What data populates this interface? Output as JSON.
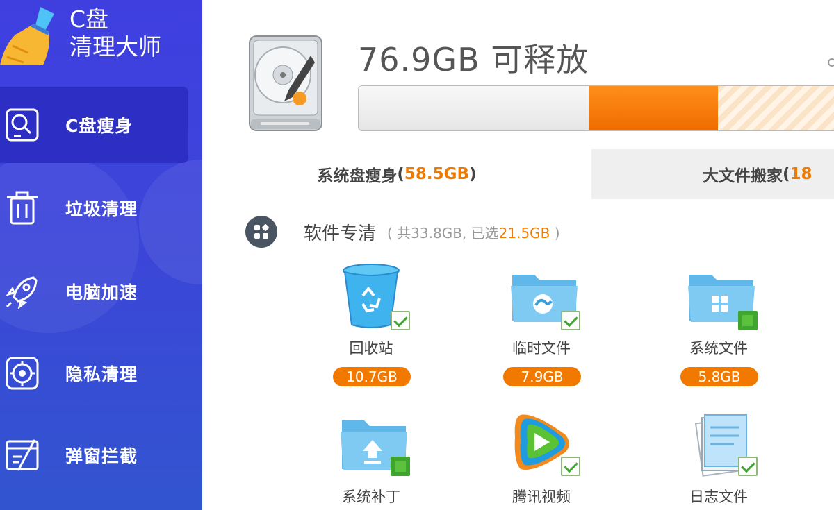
{
  "app": {
    "logo_line1": "C盘",
    "logo_line2": "清理大师"
  },
  "sidebar": {
    "items": [
      {
        "label": "C盘瘦身",
        "icon": "disk-magnifier-icon",
        "active": true
      },
      {
        "label": "垃圾清理",
        "icon": "trash-can-icon",
        "active": false
      },
      {
        "label": "电脑加速",
        "icon": "rocket-icon",
        "active": false
      },
      {
        "label": "隐私清理",
        "icon": "privacy-shield-icon",
        "active": false
      },
      {
        "label": "弹窗拦截",
        "icon": "popup-block-icon",
        "active": false
      }
    ]
  },
  "header": {
    "free_title": "76.9GB 可释放",
    "progress": {
      "used_fraction": 0.475,
      "releasable_fraction": 0.265,
      "other_fraction": 0.26
    }
  },
  "tabs": [
    {
      "label": "系统盘瘦身",
      "size": "58.5GB",
      "open": " (",
      "close": ")"
    },
    {
      "label": "大文件搬家",
      "size": "18",
      "open": " (",
      "close": ""
    }
  ],
  "section": {
    "title": "软件专清",
    "meta_prefix": "( 共33.8GB, 已选",
    "meta_selected": "21.5GB",
    "meta_suffix": " )"
  },
  "items": [
    {
      "name": "回收站",
      "size": "10.7GB",
      "icon": "recycle-bin-icon",
      "checked": "check"
    },
    {
      "name": "临时文件",
      "size": "7.9GB",
      "icon": "temp-folder-icon",
      "checked": "check"
    },
    {
      "name": "系统文件",
      "size": "5.8GB",
      "icon": "system-folder-icon",
      "checked": "filled"
    },
    {
      "name": "系统补丁",
      "size": "",
      "icon": "patch-folder-icon",
      "checked": "filled"
    },
    {
      "name": "腾讯视频",
      "size": "",
      "icon": "tencent-video-icon",
      "checked": "check"
    },
    {
      "name": "日志文件",
      "size": "",
      "icon": "log-file-icon",
      "checked": "check"
    }
  ],
  "colors": {
    "sidebar": "#3b46d8",
    "accent": "#ef7a00",
    "check": "#3ea62e"
  }
}
